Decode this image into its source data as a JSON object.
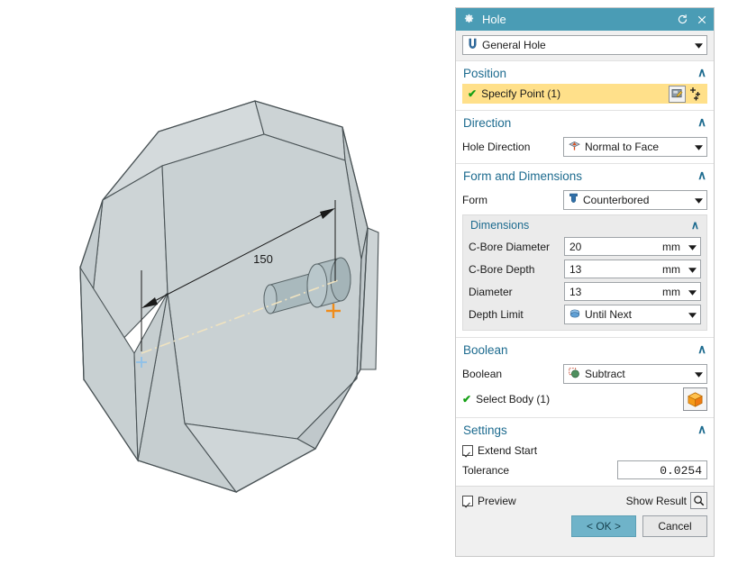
{
  "dialog": {
    "title": "Hole",
    "icons": {
      "settings": "gear-icon",
      "reset": "reset-icon",
      "close": "close-icon"
    },
    "type": {
      "label": "General Hole",
      "icon": "hole-type-icon"
    },
    "accent_color": "#4a9cb5",
    "section_color": "#1d6b8f",
    "highlight_color": "#ffe08a"
  },
  "position": {
    "title": "Position",
    "chevron": "∧",
    "specify_point": "Specify Point (1)",
    "check": "✔",
    "sketch_icon": "sketch-point-icon",
    "pointset_icon": "point-set-icon"
  },
  "direction": {
    "title": "Direction",
    "chevron": "∧",
    "hole_direction_label": "Hole Direction",
    "hole_direction_value": "Normal to Face",
    "hole_direction_icon": "normal-to-face-icon"
  },
  "form_and_dimensions": {
    "title": "Form and Dimensions",
    "chevron": "∧",
    "form_label": "Form",
    "form_value": "Counterbored",
    "form_icon": "counterbored-icon",
    "dimensions": {
      "title": "Dimensions",
      "chevron": "∧",
      "rows": [
        {
          "label": "C-Bore Diameter",
          "value": "20",
          "unit": "mm"
        },
        {
          "label": "C-Bore Depth",
          "value": "13",
          "unit": "mm"
        },
        {
          "label": "Diameter",
          "value": "13",
          "unit": "mm"
        }
      ],
      "depth_limit_label": "Depth Limit",
      "depth_limit_value": "Until Next",
      "depth_limit_icon": "until-next-icon"
    }
  },
  "boolean": {
    "title": "Boolean",
    "chevron": "∧",
    "boolean_label": "Boolean",
    "boolean_value": "Subtract",
    "boolean_icon": "subtract-icon",
    "select_body": "Select Body (1)",
    "check": "✔",
    "body_icon": "solid-body-icon"
  },
  "settings": {
    "title": "Settings",
    "chevron": "∧",
    "extend_start_label": "Extend Start",
    "extend_start_checked": true,
    "tolerance_label": "Tolerance",
    "tolerance_value": "0.0254"
  },
  "footer": {
    "preview_label": "Preview",
    "preview_checked": true,
    "show_result_label": "Show Result",
    "show_result_icon": "magnifier-icon",
    "ok_label": "< OK >",
    "cancel_label": "Cancel"
  },
  "viewport": {
    "dimension_label": "150",
    "body_fill": "#c9d1d3",
    "body_fill_light": "#d8dee0",
    "body_fill_dark": "#bcc5c7",
    "edge_color": "#4a5356",
    "preview_fill": "#a8b8bc",
    "origin_marker": "origin-crosshair",
    "point_marker": "hole-point-crosshair"
  }
}
